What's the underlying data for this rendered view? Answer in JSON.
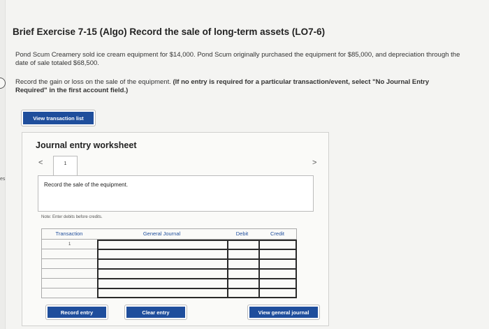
{
  "page": {
    "title": "Brief Exercise 7-15 (Algo) Record the sale of long-term assets (LO7-6)",
    "paragraph1": "Pond Scum Creamery sold ice cream equipment for $14,000. Pond Scum originally purchased the equipment for $85,000, and depreciation through the date of sale totaled $68,500.",
    "paragraph2_plain": "Record the gain or loss on the sale of the equipment. ",
    "paragraph2_bold": "(If no entry is required for a particular transaction/event, select \"No Journal Entry Required\" in the first account field.)",
    "edge_text": "es"
  },
  "buttons": {
    "view_transaction_list": "View transaction list",
    "record_entry": "Record entry",
    "clear_entry": "Clear entry",
    "view_general_journal": "View general journal"
  },
  "worksheet": {
    "title": "Journal entry worksheet",
    "nav_prev": "<",
    "nav_next": ">",
    "tab_label": "1",
    "description": "Record the sale of the equipment.",
    "note": "Note: Enter debits before credits."
  },
  "table": {
    "headers": [
      "Transaction",
      "General Journal",
      "Debit",
      "Credit"
    ],
    "transaction_number": "1"
  },
  "colors": {
    "accent": "#1f4e9c",
    "background": "#f4f4f2"
  }
}
